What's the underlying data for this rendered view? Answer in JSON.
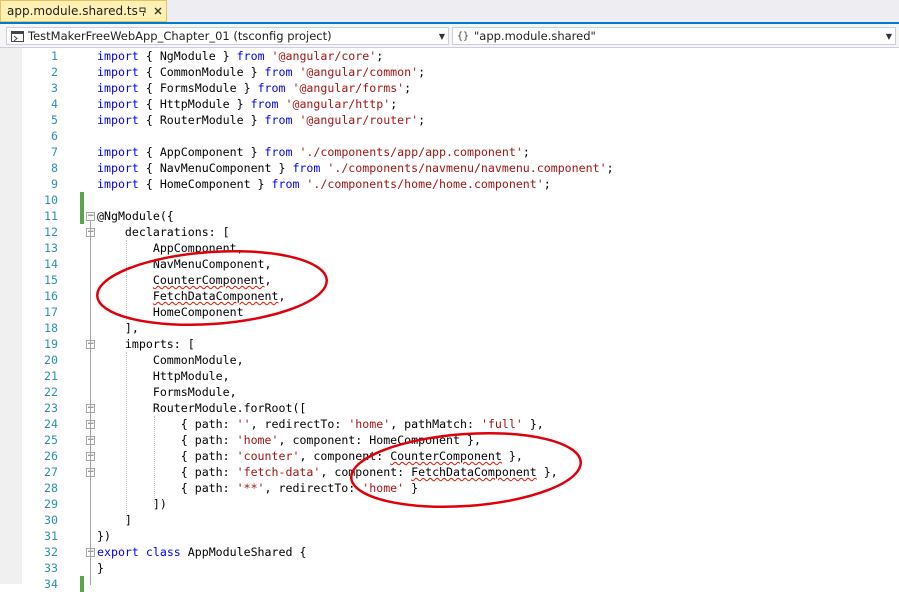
{
  "tab": {
    "title": "app.module.shared.ts",
    "pin_icon": "pin-icon",
    "close_icon": "close-icon"
  },
  "navbar": {
    "project_combo": {
      "text": "TestMakerFreeWebApp_Chapter_01 (tsconfig project)",
      "icon": "project-icon"
    },
    "scope_combo": {
      "text": "\"app.module.shared\"",
      "icon": "braces-icon"
    }
  },
  "colors": {
    "keyword": "#0000ff",
    "string": "#a31515",
    "line_number": "#2b91af",
    "accent": "#007acc",
    "annotation": "#e0000a"
  },
  "editor": {
    "lines": [
      {
        "n": "1",
        "segs": [
          [
            "kw",
            "import"
          ],
          [
            "p",
            " { NgModule } "
          ],
          [
            "kw",
            "from"
          ],
          [
            "p",
            " "
          ],
          [
            "str",
            "'@angular/core'"
          ],
          [
            "p",
            ";"
          ]
        ]
      },
      {
        "n": "2",
        "segs": [
          [
            "kw",
            "import"
          ],
          [
            "p",
            " { CommonModule } "
          ],
          [
            "kw",
            "from"
          ],
          [
            "p",
            " "
          ],
          [
            "str",
            "'@angular/common'"
          ],
          [
            "p",
            ";"
          ]
        ]
      },
      {
        "n": "3",
        "segs": [
          [
            "kw",
            "import"
          ],
          [
            "p",
            " { FormsModule } "
          ],
          [
            "kw",
            "from"
          ],
          [
            "p",
            " "
          ],
          [
            "str",
            "'@angular/forms'"
          ],
          [
            "p",
            ";"
          ]
        ]
      },
      {
        "n": "4",
        "segs": [
          [
            "kw",
            "import"
          ],
          [
            "p",
            " { HttpModule } "
          ],
          [
            "kw",
            "from"
          ],
          [
            "p",
            " "
          ],
          [
            "str",
            "'@angular/http'"
          ],
          [
            "p",
            ";"
          ]
        ]
      },
      {
        "n": "5",
        "segs": [
          [
            "kw",
            "import"
          ],
          [
            "p",
            " { RouterModule } "
          ],
          [
            "kw",
            "from"
          ],
          [
            "p",
            " "
          ],
          [
            "str",
            "'@angular/router'"
          ],
          [
            "p",
            ";"
          ]
        ]
      },
      {
        "n": "6",
        "segs": []
      },
      {
        "n": "7",
        "segs": [
          [
            "kw",
            "import"
          ],
          [
            "p",
            " { AppComponent } "
          ],
          [
            "kw",
            "from"
          ],
          [
            "p",
            " "
          ],
          [
            "str",
            "'./components/app/app.component'"
          ],
          [
            "p",
            ";"
          ]
        ]
      },
      {
        "n": "8",
        "segs": [
          [
            "kw",
            "import"
          ],
          [
            "p",
            " { NavMenuComponent } "
          ],
          [
            "kw",
            "from"
          ],
          [
            "p",
            " "
          ],
          [
            "str",
            "'./components/navmenu/navmenu.component'"
          ],
          [
            "p",
            ";"
          ]
        ]
      },
      {
        "n": "9",
        "segs": [
          [
            "kw",
            "import"
          ],
          [
            "p",
            " { HomeComponent } "
          ],
          [
            "kw",
            "from"
          ],
          [
            "p",
            " "
          ],
          [
            "str",
            "'./components/home/home.component'"
          ],
          [
            "p",
            ";"
          ]
        ]
      },
      {
        "n": "10",
        "segs": []
      },
      {
        "n": "11",
        "segs": [
          [
            "p",
            "@NgModule({"
          ]
        ]
      },
      {
        "n": "12",
        "segs": [
          [
            "p",
            "    declarations: ["
          ]
        ]
      },
      {
        "n": "13",
        "segs": [
          [
            "p",
            "        AppComponent,"
          ]
        ]
      },
      {
        "n": "14",
        "segs": [
          [
            "p",
            "        NavMenuComponent,"
          ]
        ]
      },
      {
        "n": "15",
        "segs": [
          [
            "p",
            "        "
          ],
          [
            "sq",
            "CounterComponent"
          ],
          [
            "p",
            ","
          ]
        ]
      },
      {
        "n": "16",
        "segs": [
          [
            "p",
            "        "
          ],
          [
            "sq",
            "FetchDataComponent"
          ],
          [
            "p",
            ","
          ]
        ]
      },
      {
        "n": "17",
        "segs": [
          [
            "p",
            "        HomeComponent"
          ]
        ]
      },
      {
        "n": "18",
        "segs": [
          [
            "p",
            "    ],"
          ]
        ]
      },
      {
        "n": "19",
        "segs": [
          [
            "p",
            "    imports: ["
          ]
        ]
      },
      {
        "n": "20",
        "segs": [
          [
            "p",
            "        CommonModule,"
          ]
        ]
      },
      {
        "n": "21",
        "segs": [
          [
            "p",
            "        HttpModule,"
          ]
        ]
      },
      {
        "n": "22",
        "segs": [
          [
            "p",
            "        FormsModule,"
          ]
        ]
      },
      {
        "n": "23",
        "segs": [
          [
            "p",
            "        RouterModule.forRoot(["
          ]
        ]
      },
      {
        "n": "24",
        "segs": [
          [
            "p",
            "            { path: "
          ],
          [
            "str",
            "''"
          ],
          [
            "p",
            ", redirectTo: "
          ],
          [
            "str",
            "'home'"
          ],
          [
            "p",
            ", pathMatch: "
          ],
          [
            "str",
            "'full'"
          ],
          [
            "p",
            " },"
          ]
        ]
      },
      {
        "n": "25",
        "segs": [
          [
            "p",
            "            { path: "
          ],
          [
            "str",
            "'home'"
          ],
          [
            "p",
            ", component: HomeComponent },"
          ]
        ]
      },
      {
        "n": "26",
        "segs": [
          [
            "p",
            "            { path: "
          ],
          [
            "str",
            "'counter'"
          ],
          [
            "p",
            ", component: "
          ],
          [
            "sq",
            "CounterComponent"
          ],
          [
            "p",
            " },"
          ]
        ]
      },
      {
        "n": "27",
        "segs": [
          [
            "p",
            "            { path: "
          ],
          [
            "str",
            "'fetch-data'"
          ],
          [
            "p",
            ", component: "
          ],
          [
            "sq",
            "FetchDataComponent"
          ],
          [
            "p",
            " },"
          ]
        ]
      },
      {
        "n": "28",
        "segs": [
          [
            "p",
            "            { path: "
          ],
          [
            "str",
            "'**'"
          ],
          [
            "p",
            ", redirectTo: "
          ],
          [
            "str",
            "'home'"
          ],
          [
            "p",
            " }"
          ]
        ]
      },
      {
        "n": "29",
        "segs": [
          [
            "p",
            "        ])"
          ]
        ]
      },
      {
        "n": "30",
        "segs": [
          [
            "p",
            "    ]"
          ]
        ]
      },
      {
        "n": "31",
        "segs": [
          [
            "p",
            "})"
          ]
        ]
      },
      {
        "n": "32",
        "segs": [
          [
            "kw",
            "export"
          ],
          [
            "p",
            " "
          ],
          [
            "kw",
            "class"
          ],
          [
            "p",
            " AppModuleShared {"
          ]
        ]
      },
      {
        "n": "33",
        "segs": [
          [
            "p",
            "}"
          ]
        ]
      },
      {
        "n": "34",
        "segs": []
      }
    ],
    "changed_lines": [
      "10",
      "11",
      "34"
    ],
    "outline_toggles": [
      "11",
      "12",
      "19",
      "23",
      "24",
      "25",
      "26",
      "27",
      "32"
    ]
  }
}
